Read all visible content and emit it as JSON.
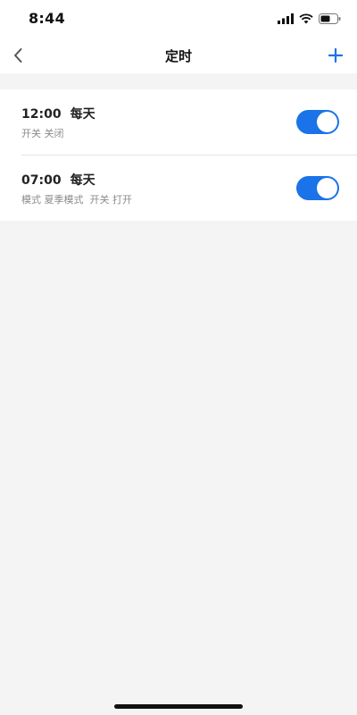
{
  "status_bar": {
    "time": "8:44"
  },
  "nav": {
    "title": "定时",
    "back_icon": "chevron-left-icon",
    "add_icon": "plus-icon"
  },
  "timers": [
    {
      "time": "12:00",
      "repeat": "每天",
      "description": "开关 关闭",
      "enabled": true
    },
    {
      "time": "07:00",
      "repeat": "每天",
      "description": "模式 夏季模式  开关 打开",
      "enabled": true
    }
  ],
  "colors": {
    "accent": "#1a73e8",
    "background": "#f4f4f4",
    "card": "#ffffff"
  }
}
